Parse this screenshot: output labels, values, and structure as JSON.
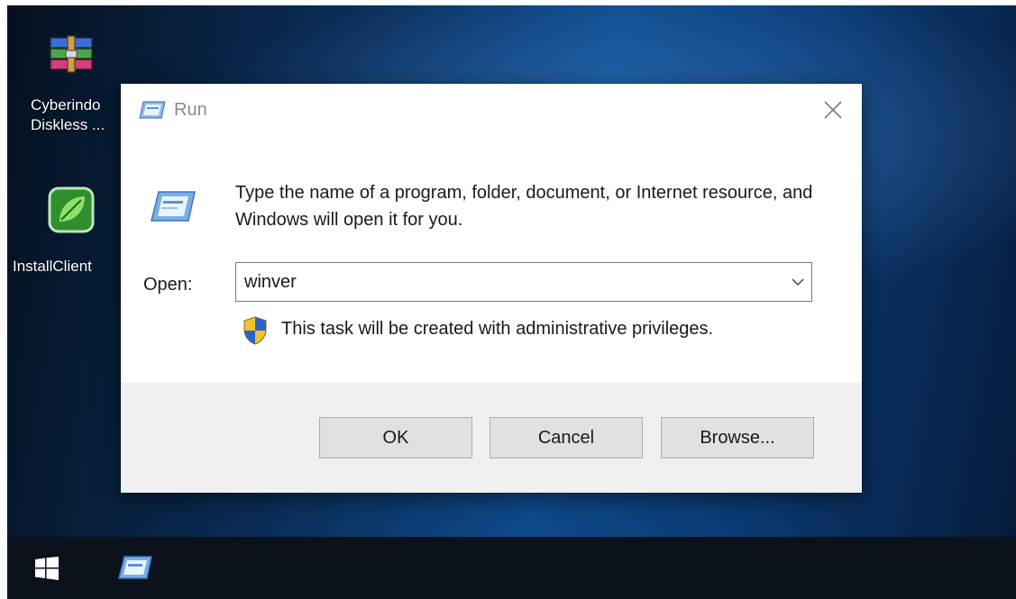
{
  "desktop": {
    "icons": [
      {
        "icon": "winrar-archive-icon",
        "label_line1": "Cyberindo",
        "label_line2": "Diskless ..."
      },
      {
        "icon": "install-client-leaf-icon",
        "label_line1": "InstallClient"
      }
    ]
  },
  "dialog": {
    "title": "Run",
    "title_icon": "run-icon",
    "close_icon": "close-icon",
    "instruction": "Type the name of a program, folder, document, or Internet resource, and Windows will open it for you.",
    "open_label": "Open:",
    "open_value": "winver",
    "admin_note": "This task will be created with administrative privileges.",
    "admin_icon": "uac-shield-icon",
    "buttons": {
      "ok": "OK",
      "cancel": "Cancel",
      "browse": "Browse..."
    }
  },
  "taskbar": {
    "start_icon": "windows-start-icon",
    "pinned": [
      {
        "icon": "run-icon"
      }
    ]
  },
  "colors": {
    "dialog_bg": "#ffffff",
    "footer_bg": "#f0f0f0",
    "button_bg": "#e1e1e1",
    "taskbar_bg": "#0b121c",
    "desktop_blue": "#0e4a8c"
  }
}
